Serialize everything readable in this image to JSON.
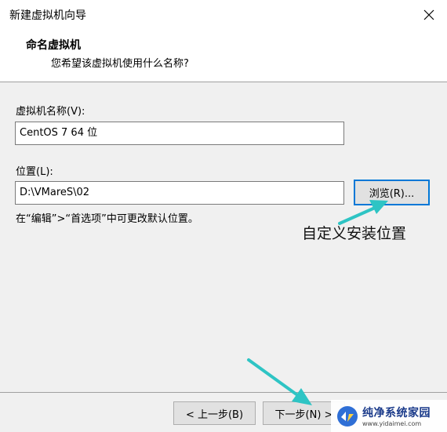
{
  "window": {
    "title": "新建虚拟机向导"
  },
  "header": {
    "title": "命名虚拟机",
    "subtitle": "您希望该虚拟机使用什么名称?"
  },
  "form": {
    "name_label": "虚拟机名称(V):",
    "name_value": "CentOS 7 64 位",
    "location_label": "位置(L):",
    "location_value": "D:\\VMareS\\02",
    "browse_label": "浏览(R)...",
    "hint": "在“编辑”>“首选项”中可更改默认位置。"
  },
  "annotation": {
    "text": "自定义安装位置",
    "arrow_color": "#2ec4c4"
  },
  "footer": {
    "back_label": "< 上一步(B)",
    "next_label": "下一步(N) >"
  },
  "watermark": {
    "main": "纯净系统家园",
    "url": "www.yidaimei.com"
  },
  "icons": {
    "close": "close-icon",
    "watermark_logo": "watermark-logo-icon"
  }
}
